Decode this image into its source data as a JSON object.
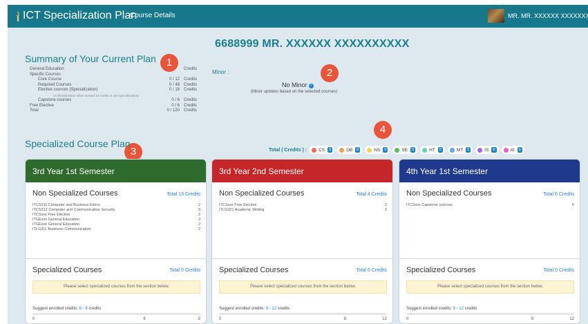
{
  "app": {
    "title": "ICT Specialization Plan",
    "nav_link": "Course Details",
    "user": "MR. MR. XXXXXX XXXXXXXXXX"
  },
  "student_heading": "6688999 MR. XXXXXX XXXXXXXXXX",
  "summary": {
    "title": "Summary of Your Current Plan",
    "rows": [
      {
        "label": "General Education",
        "value": "",
        "unit": "Credits",
        "level": 1
      },
      {
        "label": "Specific Courses",
        "value": "",
        "unit": "",
        "level": 1
      },
      {
        "label": "Core Course",
        "value": "0 / 12",
        "unit": "Credits",
        "level": 2
      },
      {
        "label": "Required Courses",
        "value": "0 / 48",
        "unit": "Credits",
        "level": 2
      },
      {
        "label": "Elective courses (Specialization)",
        "value": "0 / 18",
        "unit": "Credits",
        "level": 2
      },
      {
        "label": "(Achieved Minor when earned 15 credits in one specialization)",
        "value": "",
        "unit": "",
        "level": 4
      },
      {
        "label": "Capstone courses",
        "value": "0 / 6",
        "unit": "Credits",
        "level": 2
      },
      {
        "label": "Free Elective",
        "value": "0 / 6",
        "unit": "Credits",
        "level": 1
      },
      {
        "label": "Total",
        "value": "0 / 120",
        "unit": "Credits",
        "level": 1
      }
    ]
  },
  "minor": {
    "label": "Minor :",
    "value": "No Minor",
    "note": "(Minor updates based on the selected courses)"
  },
  "badges": [
    "1",
    "2",
    "3",
    "4"
  ],
  "plan": {
    "title": "Specialized Course Plan",
    "totals_label": "Total ( Credits ) :",
    "chips": [
      {
        "name": "CS",
        "count": "0",
        "color": "#ef6a57"
      },
      {
        "name": "DB",
        "count": "0",
        "color": "#f0a23a"
      },
      {
        "name": "NS",
        "count": "0",
        "color": "#f1d74b"
      },
      {
        "name": "SE",
        "count": "0",
        "color": "#52c25a"
      },
      {
        "name": "HT",
        "count": "0",
        "color": "#5fd6b8"
      },
      {
        "name": "MT",
        "count": "0",
        "color": "#62a7e8"
      },
      {
        "name": "IS",
        "count": "0",
        "color": "#9d69d6"
      },
      {
        "name": "AI",
        "count": "0",
        "color": "#ee5fb6"
      }
    ]
  },
  "semesters": [
    {
      "title": "3rd Year 1st Semester",
      "color": "#2e6b2c",
      "non_spec_title": "Non Specialized Courses",
      "non_spec_total": "Total 13 Credits",
      "courses": [
        {
          "name": "ITCS311  Computer and Business Ethics",
          "credits": "2"
        },
        {
          "name": "ITCS312  Computer and Communication Security",
          "credits": "3"
        },
        {
          "name": "ITCSxxx  Free Elective",
          "credits": "2"
        },
        {
          "name": "ITGExxx  General Education",
          "credits": "2"
        },
        {
          "name": "ITGExxx  General Education",
          "credits": "2"
        },
        {
          "name": "ITLG311  Business Communication",
          "credits": "2"
        }
      ],
      "spec_title": "Specialized Courses",
      "spec_total": "Total 0 Credits",
      "notice": "Please select specialized courses from the section below.",
      "suggest_label": "Suggest enrolled credits:",
      "suggest_range": "6 - 9",
      "suggest_unit": "credits",
      "ticks": [
        "0",
        "6",
        "9"
      ],
      "tick_pos": [
        0,
        0.667,
        1.0
      ]
    },
    {
      "title": "3rd Year 2nd Semester",
      "color": "#c4262a",
      "non_spec_title": "Non Specialized Courses",
      "non_spec_total": "Total 4 Credits",
      "courses": [
        {
          "name": "ITCSxxx  Free Elective",
          "credits": "2"
        },
        {
          "name": "ITLG321  Academic Writing",
          "credits": "2"
        }
      ],
      "spec_title": "Specialized Courses",
      "spec_total": "Total 0 Credits",
      "notice": "Please select specialized courses from the section below.",
      "suggest_label": "Suggest enrolled credits:",
      "suggest_range": "9 - 12",
      "suggest_unit": "credits",
      "ticks": [
        "0",
        "9",
        "12"
      ],
      "tick_pos": [
        0,
        0.75,
        1.0
      ]
    },
    {
      "title": "4th Year 1st Semester",
      "color": "#1f3a8c",
      "non_spec_title": "Non Specialized Courses",
      "non_spec_total": "Total 6 Credits",
      "courses": [
        {
          "name": "ITCSxxx  Capstone courses",
          "credits": "6"
        }
      ],
      "spec_title": "Specialized Courses",
      "spec_total": "Total 0 Credits",
      "notice": "Please select specialized courses from the section below.",
      "suggest_label": "Suggest enrolled credits:",
      "suggest_range": "9 - 12",
      "suggest_unit": "credits",
      "ticks": [
        "0",
        "9",
        "12"
      ],
      "tick_pos": [
        0,
        0.75,
        1.0
      ]
    }
  ]
}
